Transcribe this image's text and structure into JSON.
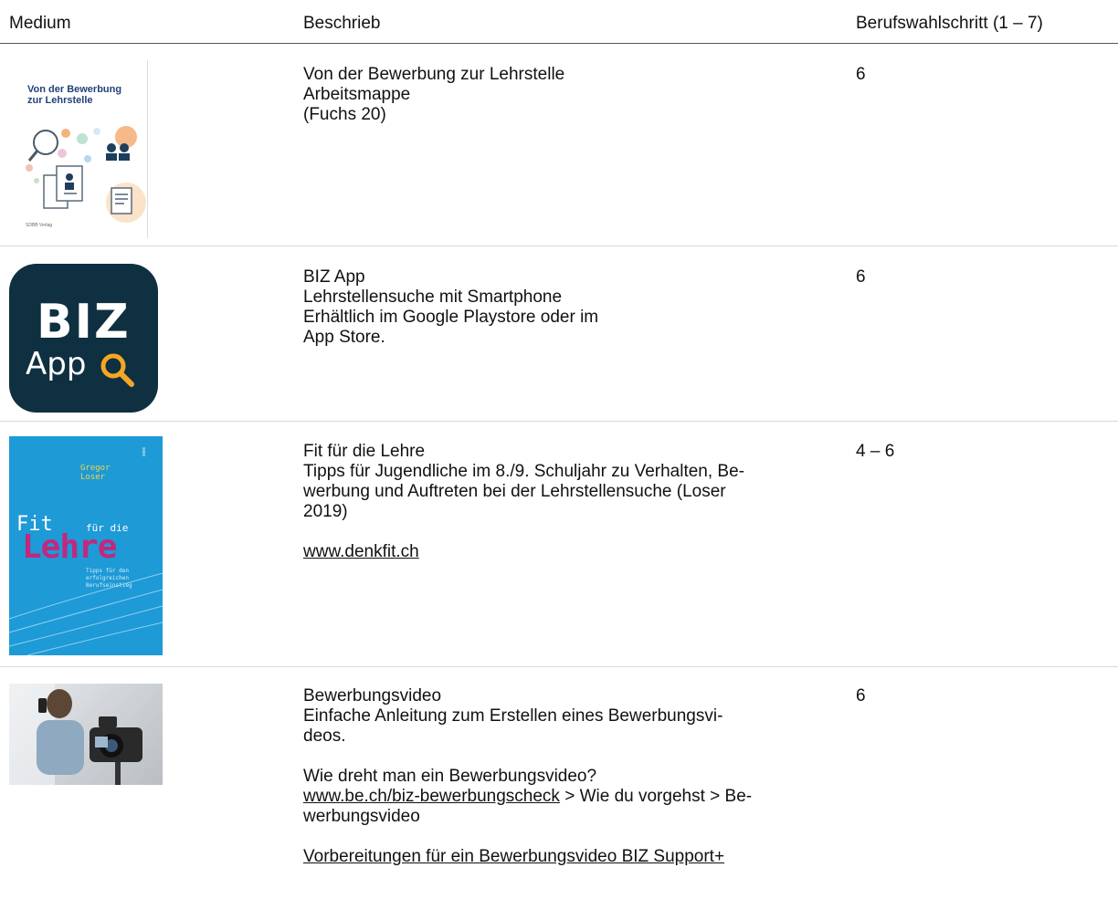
{
  "header": {
    "col_medium": "Medium",
    "col_desc": "Beschrieb",
    "col_step": "Berufswahlschritt (1 – 7)"
  },
  "rows": [
    {
      "cover_title_1": "Von der Bewerbung",
      "cover_title_2": "zur Lehrstelle",
      "cover_publisher": "SDBB Verlag",
      "lines": [
        "Von der Bewerbung zur Lehrstelle",
        "Arbeitsmappe",
        "(Fuchs 20)"
      ],
      "step": "6"
    },
    {
      "icon_big": "BIZ",
      "icon_small": "App",
      "lines": [
        "BIZ App",
        "Lehrstellensuche mit Smartphone",
        "Erhältlich im Google Playstore oder im",
        "App Store."
      ],
      "step": "6"
    },
    {
      "cover_author_1": "Gregor",
      "cover_author_2": "Loser",
      "cover_fit": "Fit",
      "cover_fur": "für die",
      "cover_lehre": "Lehre",
      "cover_sub_1": "Tipps für den",
      "cover_sub_2": "erfolgreichen",
      "cover_sub_3": "Berufseinstieg",
      "cover_publisher": "xxxx",
      "lines": [
        "Fit für die Lehre",
        "Tipps für Jugendliche im 8./9. Schuljahr zu Verhalten, Be-",
        "werbung und Auftreten bei der Lehrstellensuche (Loser",
        "2019)"
      ],
      "link": "www.denkfit.ch",
      "step": "4 – 6"
    },
    {
      "lines": [
        "Bewerbungsvideo",
        "Einfache Anleitung zum Erstellen eines Bewerbungsvi-",
        "deos."
      ],
      "question": "Wie dreht man ein Bewerbungsvideo?",
      "link": "www.be.ch/biz-bewerbungscheck",
      "link_after": " > Wie du vorgehst > Be-",
      "link_cont": "werbungsvideo",
      "link2": "Vorbereitungen für ein Bewerbungsvideo BIZ Support+",
      "step": "6"
    }
  ],
  "colors": {
    "biz_app_bg": "#0f3040",
    "biz_magnifier": "#f5a623",
    "fit_cover_bg": "#1e9ad6",
    "fit_lehre": "#c2287e"
  }
}
